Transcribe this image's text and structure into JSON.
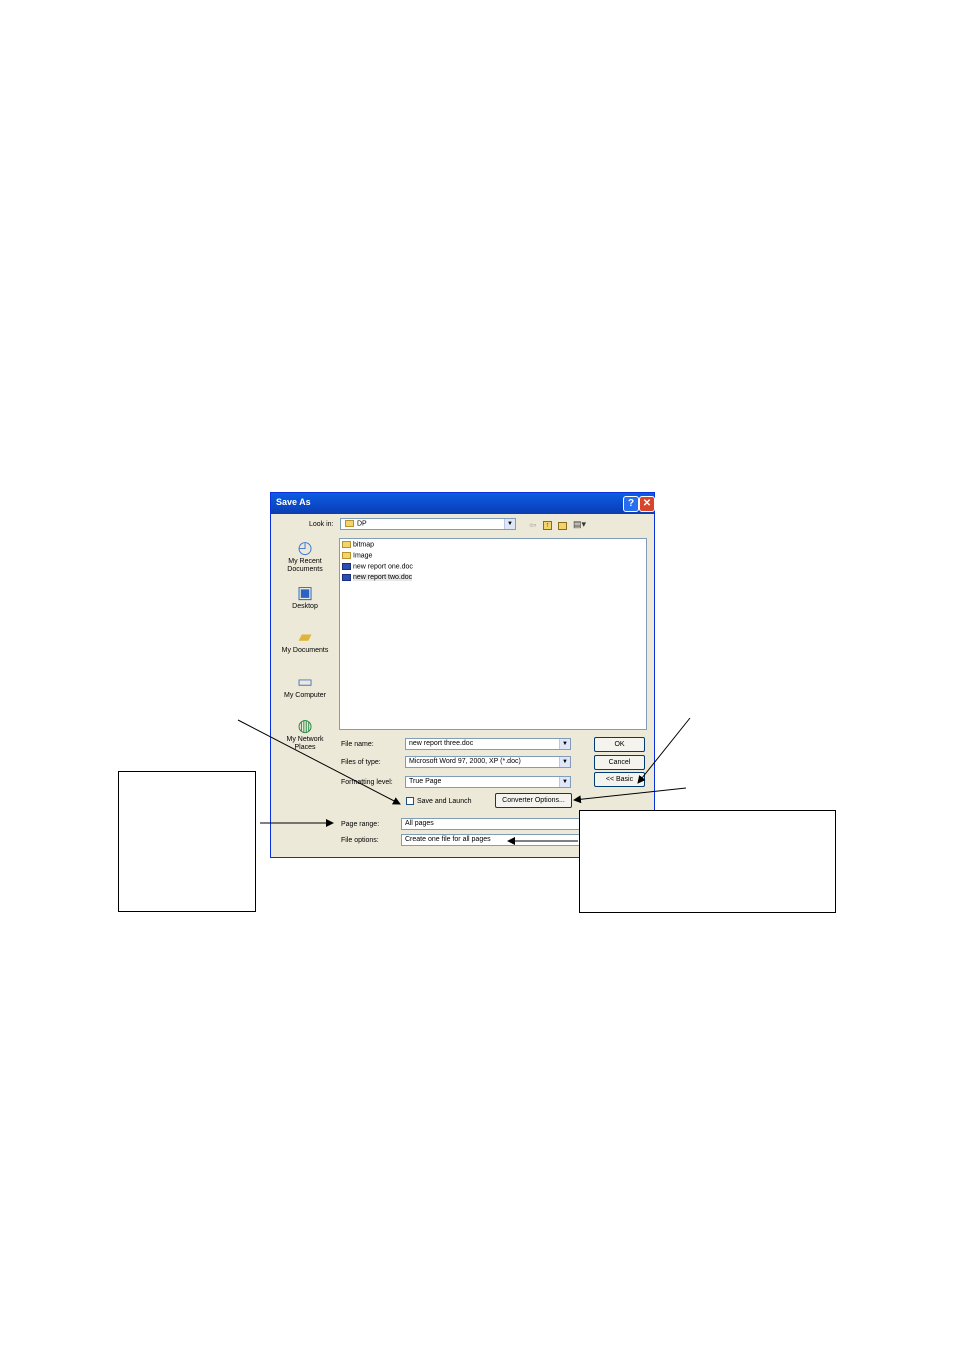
{
  "dialog": {
    "title": "Save As",
    "help_glyph": "?",
    "close_glyph": "✕",
    "look_in_label": "Look in:",
    "look_in_value": "DP",
    "toolbar_icons": [
      "back-icon",
      "up-folder-icon",
      "new-folder-icon",
      "views-menu-icon"
    ],
    "places": [
      {
        "label": "My Recent Documents",
        "icon": "recent-documents-icon"
      },
      {
        "label": "Desktop",
        "icon": "desktop-icon"
      },
      {
        "label": "My Documents",
        "icon": "my-documents-icon"
      },
      {
        "label": "My Computer",
        "icon": "my-computer-icon"
      },
      {
        "label": "My Network Places",
        "icon": "network-places-icon"
      }
    ],
    "files": [
      {
        "name": "bitmap",
        "type": "folder"
      },
      {
        "name": "Image",
        "type": "folder"
      },
      {
        "name": "new report one.doc",
        "type": "doc"
      },
      {
        "name": "new report two.doc",
        "type": "doc"
      }
    ],
    "file_name_label": "File name:",
    "file_name_value": "new report three.doc",
    "files_of_type_label": "Files of type:",
    "files_of_type_value": "Microsoft Word 97, 2000, XP (*.doc)",
    "formatting_level_label": "Formatting level:",
    "formatting_level_value": "True Page",
    "save_launch_label": "Save and Launch",
    "save_launch_checked": false,
    "converter_options_label": "Converter Options...",
    "page_range_label": "Page range:",
    "page_range_value": "All pages",
    "file_options_label": "File options:",
    "file_options_value": "Create one file for all pages",
    "ok_label": "OK",
    "cancel_label": "Cancel",
    "basic_label": "<< Basic"
  }
}
